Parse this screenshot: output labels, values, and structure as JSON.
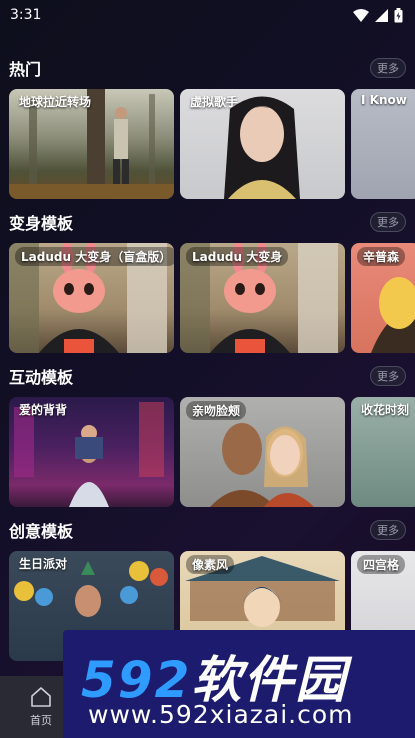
{
  "status": {
    "time": "3:31"
  },
  "more_label": "更多",
  "sections": [
    {
      "title": "热门",
      "cards": [
        "地球拉近转场",
        "虚拟歌手",
        "I Know"
      ]
    },
    {
      "title": "变身模板",
      "cards": [
        "Ladudu 大变身（盲盒版）",
        "Ladudu 大变身",
        "辛普森"
      ]
    },
    {
      "title": "互动模板",
      "cards": [
        "爱的背背",
        "亲吻脸颊",
        "收花时刻"
      ]
    },
    {
      "title": "创意模板",
      "cards": [
        "生日派对",
        "像素风",
        "四宫格"
      ]
    }
  ],
  "nav": {
    "home_label": "首页"
  },
  "watermark": {
    "brand_num": "592",
    "brand_text": "软件园",
    "url": "www.592xiazai.com"
  }
}
